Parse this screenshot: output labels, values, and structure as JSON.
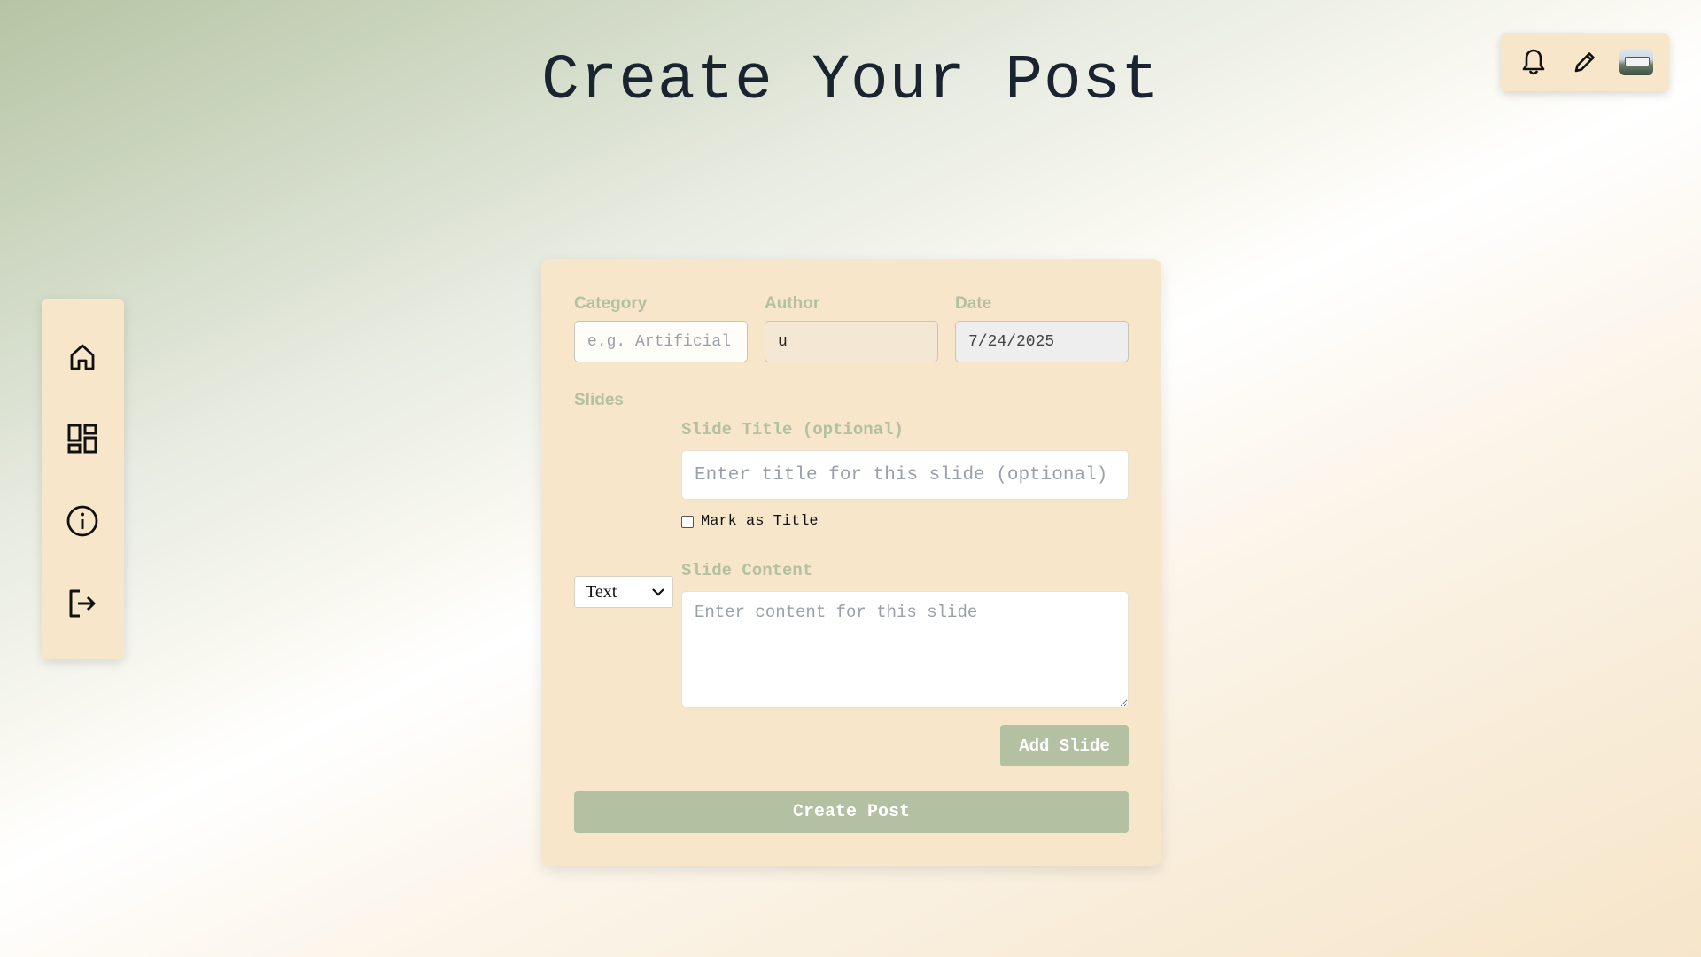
{
  "page": {
    "title": "Create Your Post"
  },
  "toolbar": {
    "icons": [
      "bell-icon",
      "pencil-icon",
      "avatar"
    ]
  },
  "sidebar": {
    "items": [
      {
        "icon": "home-icon"
      },
      {
        "icon": "dashboard-icon"
      },
      {
        "icon": "info-icon"
      },
      {
        "icon": "logout-icon"
      }
    ]
  },
  "form": {
    "category_label": "Category",
    "category_placeholder": "e.g. Artificial Intelligence",
    "author_label": "Author",
    "author_value": "u",
    "date_label": "Date",
    "date_value": "7/24/2025",
    "slides_label": "Slides",
    "slide_type_value": "Text",
    "slide_title_label": "Slide Title (optional)",
    "slide_title_placeholder": "Enter title for this slide (optional)",
    "mark_as_title_label": "Mark as Title",
    "slide_content_label": "Slide Content",
    "slide_content_placeholder": "Enter content for this slide",
    "add_slide_label": "Add Slide",
    "create_post_label": "Create Post"
  },
  "colors": {
    "accent": "#b3c1a2",
    "panel": "#f7e6c9",
    "title": "#1a2330"
  }
}
